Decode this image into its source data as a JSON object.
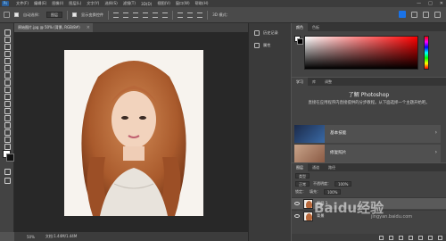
{
  "menubar": {
    "logo": "Ps",
    "items": [
      "文件(F)",
      "编辑(E)",
      "图像(I)",
      "图层(L)",
      "文字(Y)",
      "选择(S)",
      "滤镜(T)",
      "3D(D)",
      "视图(V)",
      "窗口(W)",
      "帮助(H)"
    ],
    "minimize": "—",
    "maximize": "□",
    "close": "✕"
  },
  "options": {
    "auto_select_label": "自动选择：",
    "auto_select_value": "图层",
    "transform_label": "显示变换控件",
    "mode_label": "3D 模式："
  },
  "document": {
    "tab_title": "原始图片.jpg @ 50% (背景, RGB/8#)",
    "zoom": "50%",
    "doc_info": "文档:1.44M/1.44M"
  },
  "midstrip": {
    "history_label": "历史记录",
    "properties_label": "属性"
  },
  "color_panel": {
    "tabs": [
      "颜色",
      "色板"
    ]
  },
  "learn_panel": {
    "tabs": [
      "学习",
      "库",
      "调整"
    ],
    "title": "了解 Photoshop",
    "description": "直接在应用程序内直接提供的分步教程。从下面选择一个主题开始吧。",
    "cards": [
      {
        "title": "基本技能"
      },
      {
        "title": "修复照片"
      }
    ]
  },
  "layers_panel": {
    "tabs": [
      "图层",
      "通道",
      "路径"
    ],
    "filter_label": "类型",
    "blend_mode": "正常",
    "opacity_label": "不透明度：",
    "opacity_value": "100%",
    "lock_label": "锁定：",
    "fill_label": "填充：",
    "fill_value": "100%",
    "layers": [
      {
        "name": "图层 1",
        "selected": true
      },
      {
        "name": "背景",
        "selected": false
      }
    ]
  },
  "watermark": {
    "text": "Baidu经验",
    "sub": "jingyan.baidu.com"
  },
  "colors": {
    "ui_dark": "#3c3c3c",
    "ui_panel": "#434343",
    "canvas_bg": "#282828",
    "hair": "#b9683a"
  }
}
